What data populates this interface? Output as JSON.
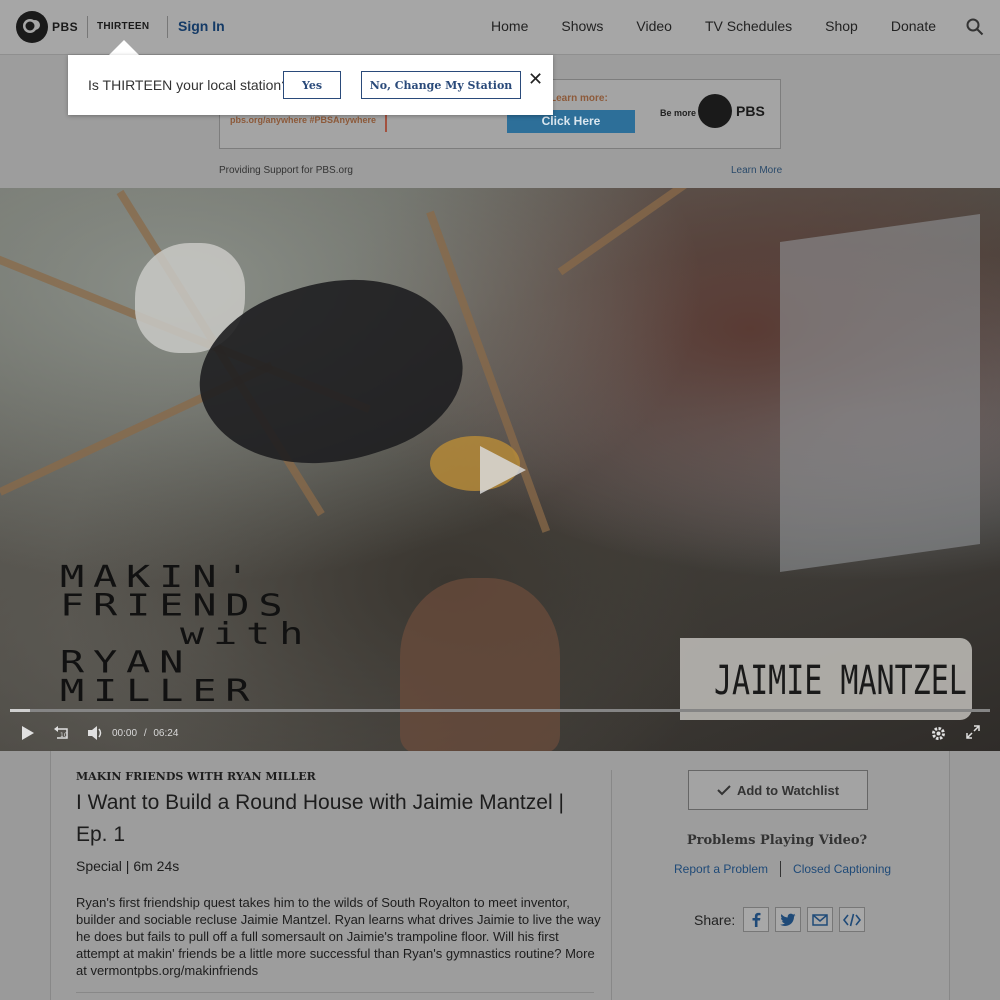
{
  "header": {
    "logo_text": "PBS",
    "station": "THIRTEEN",
    "sign_in": "Sign In",
    "nav": [
      "Home",
      "Shows",
      "Video",
      "TV Schedules",
      "Shop",
      "Donate"
    ]
  },
  "ad": {
    "url_text": "pbs.org/anywhere  #PBSAnywhere",
    "learn_more": "Learn more:",
    "click_here": "Click Here",
    "be_more": "Be more",
    "pbs": "PBS",
    "providing": "Providing Support for PBS.org",
    "learn_link": "Learn More"
  },
  "popover": {
    "question": "Is THIRTEEN your local station?",
    "yes": "Yes",
    "no": "No, Change My Station",
    "close": "✕"
  },
  "video": {
    "overlay_lines": [
      "MAKIN'",
      "FRIENDS",
      "with",
      "RYAN",
      "MILLER"
    ],
    "name_plate": "JAIMIE  MANTZEL",
    "current_time": "00:00",
    "time_sep": "/",
    "duration": "06:24",
    "progress_fraction": 0.02
  },
  "episode": {
    "show": "MAKIN FRIENDS WITH RYAN MILLER",
    "title": "I Want to Build a Round House with Jaimie Mantzel | Ep. 1",
    "meta": "Special | 6m 24s",
    "description": "Ryan's first friendship quest takes him to the wilds of South Royalton to meet inventor, builder and sociable recluse Jaimie Mantzel. Ryan learns what drives Jaimie to live the way he does but fails to pull off a full somersault on Jaimie's trampoline floor. Will his first attempt at makin' friends be a little more successful than Ryan's gymnastics routine? More at vermontpbs.org/makinfriends"
  },
  "sidebar": {
    "watchlist": "Add to Watchlist",
    "problems": "Problems Playing Video?",
    "report": "Report a Problem",
    "captioning": "Closed Captioning",
    "share": "Share:"
  }
}
